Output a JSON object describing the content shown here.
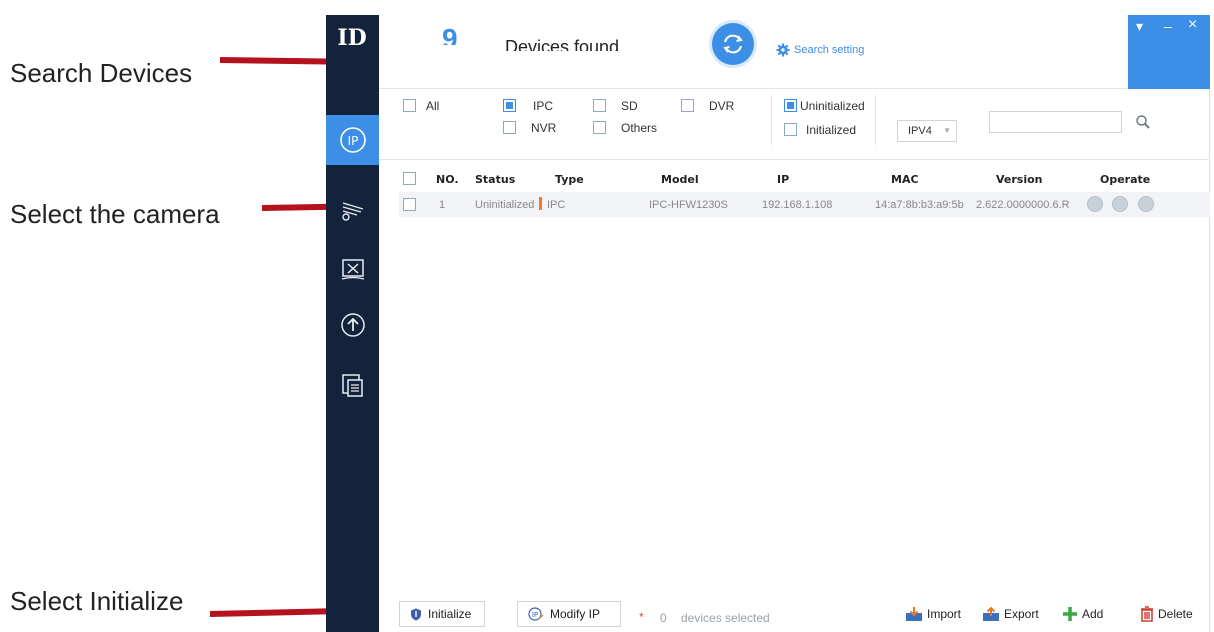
{
  "annotations": {
    "search_devices": "Search Devices",
    "select_camera": "Select the camera",
    "select_initialize": "Select Initialize"
  },
  "header": {
    "device_count": "9",
    "devices_found": "Devices found",
    "search_setting": "Search setting"
  },
  "window_controls": {
    "menu": "▾",
    "minimize": "–",
    "close": "×"
  },
  "filters": {
    "all": "All",
    "ipc": "IPC",
    "sd": "SD",
    "dvr": "DVR",
    "nvr": "NVR",
    "others": "Others",
    "uninitialized": "Uninitialized",
    "initialized": "Initialized",
    "ip_version": "IPV4",
    "search_value": "",
    "checked": {
      "ipc": true,
      "uninitialized": true,
      "all": false,
      "sd": false,
      "dvr": false,
      "nvr": false,
      "others": false,
      "initialized": false
    }
  },
  "table": {
    "columns": [
      "NO.",
      "Status",
      "Type",
      "Model",
      "IP",
      "MAC",
      "Version",
      "Operate"
    ],
    "rows": [
      {
        "no": "1",
        "status": "Uninitialized",
        "type": "IPC",
        "model": "IPC-HFW1230S",
        "ip": "192.168.1.108",
        "mac": "14:a7:8b:b3:a9:5b",
        "version": "2.622.0000000.6.R"
      }
    ]
  },
  "footer": {
    "initialize": "Initialize",
    "modify_ip": "Modify IP",
    "star": "*",
    "selected_count": "0",
    "selected_text": "devices selected",
    "import": "Import",
    "export": "Export",
    "add": "Add",
    "delete": "Delete"
  },
  "colors": {
    "accent": "#3c8ee6",
    "sidebar": "#13233c",
    "arrow": "#b5121b",
    "type_marker": "#f07a2a"
  }
}
